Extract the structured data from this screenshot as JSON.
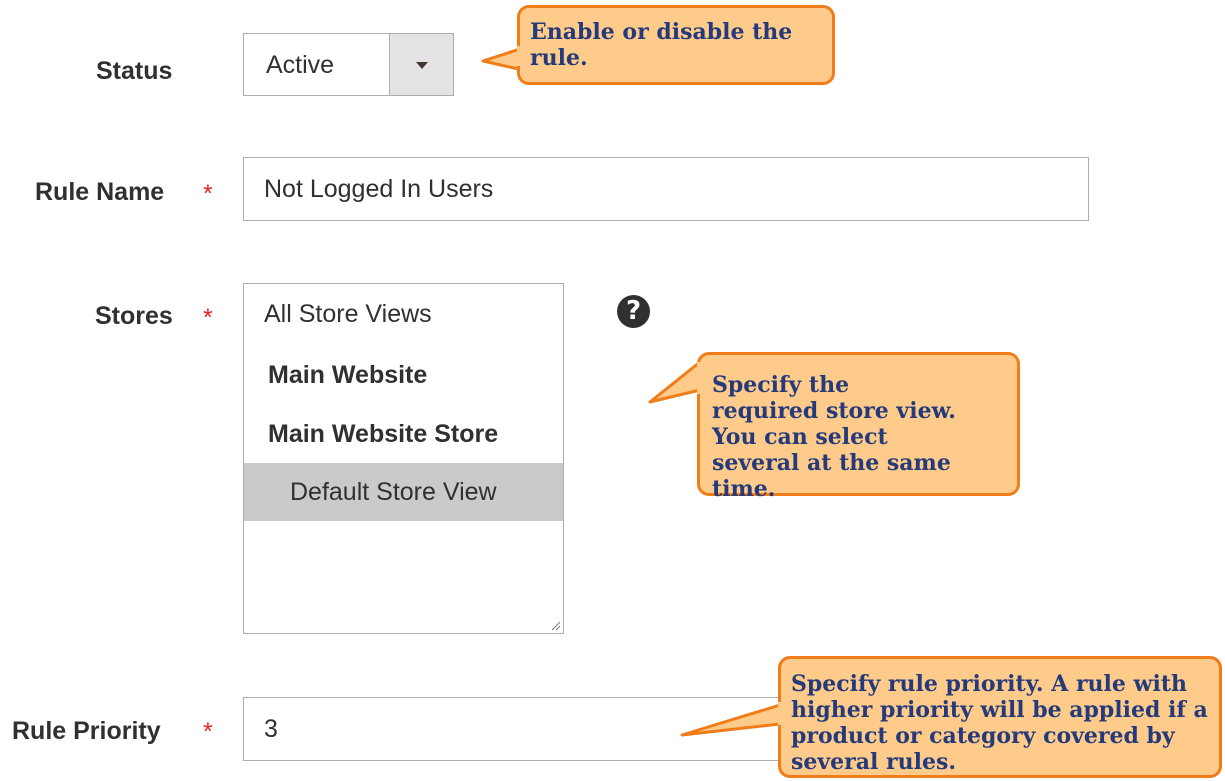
{
  "form": {
    "status": {
      "label": "Status",
      "value": "Active"
    },
    "rule_name": {
      "label": "Rule Name",
      "required_mark": "*",
      "value": "Not Logged In Users"
    },
    "stores": {
      "label": "Stores",
      "required_mark": "*",
      "options": [
        {
          "label": "All Store Views",
          "style": "plain",
          "selected": false
        },
        {
          "label": "Main Website",
          "style": "group",
          "selected": false
        },
        {
          "label": "Main Website Store",
          "style": "group",
          "selected": false
        },
        {
          "label": "Default Store View",
          "style": "indented",
          "selected": true
        }
      ],
      "help_icon": "question-circle-icon"
    },
    "rule_priority": {
      "label": "Rule Priority",
      "required_mark": "*",
      "value": "3"
    }
  },
  "callouts": {
    "status": "Enable or disable the rule.",
    "stores": "Specify the required store view. You can select several at the same time.",
    "priority": "Specify rule priority. A rule with higher priority  will be applied if a product or category covered by  several rules."
  },
  "colors": {
    "required": "#e22626",
    "callout_fill": "#ffcb8a",
    "callout_border": "#f07c1a",
    "callout_text": "#243a7a",
    "selected_option": "#cacaca"
  }
}
